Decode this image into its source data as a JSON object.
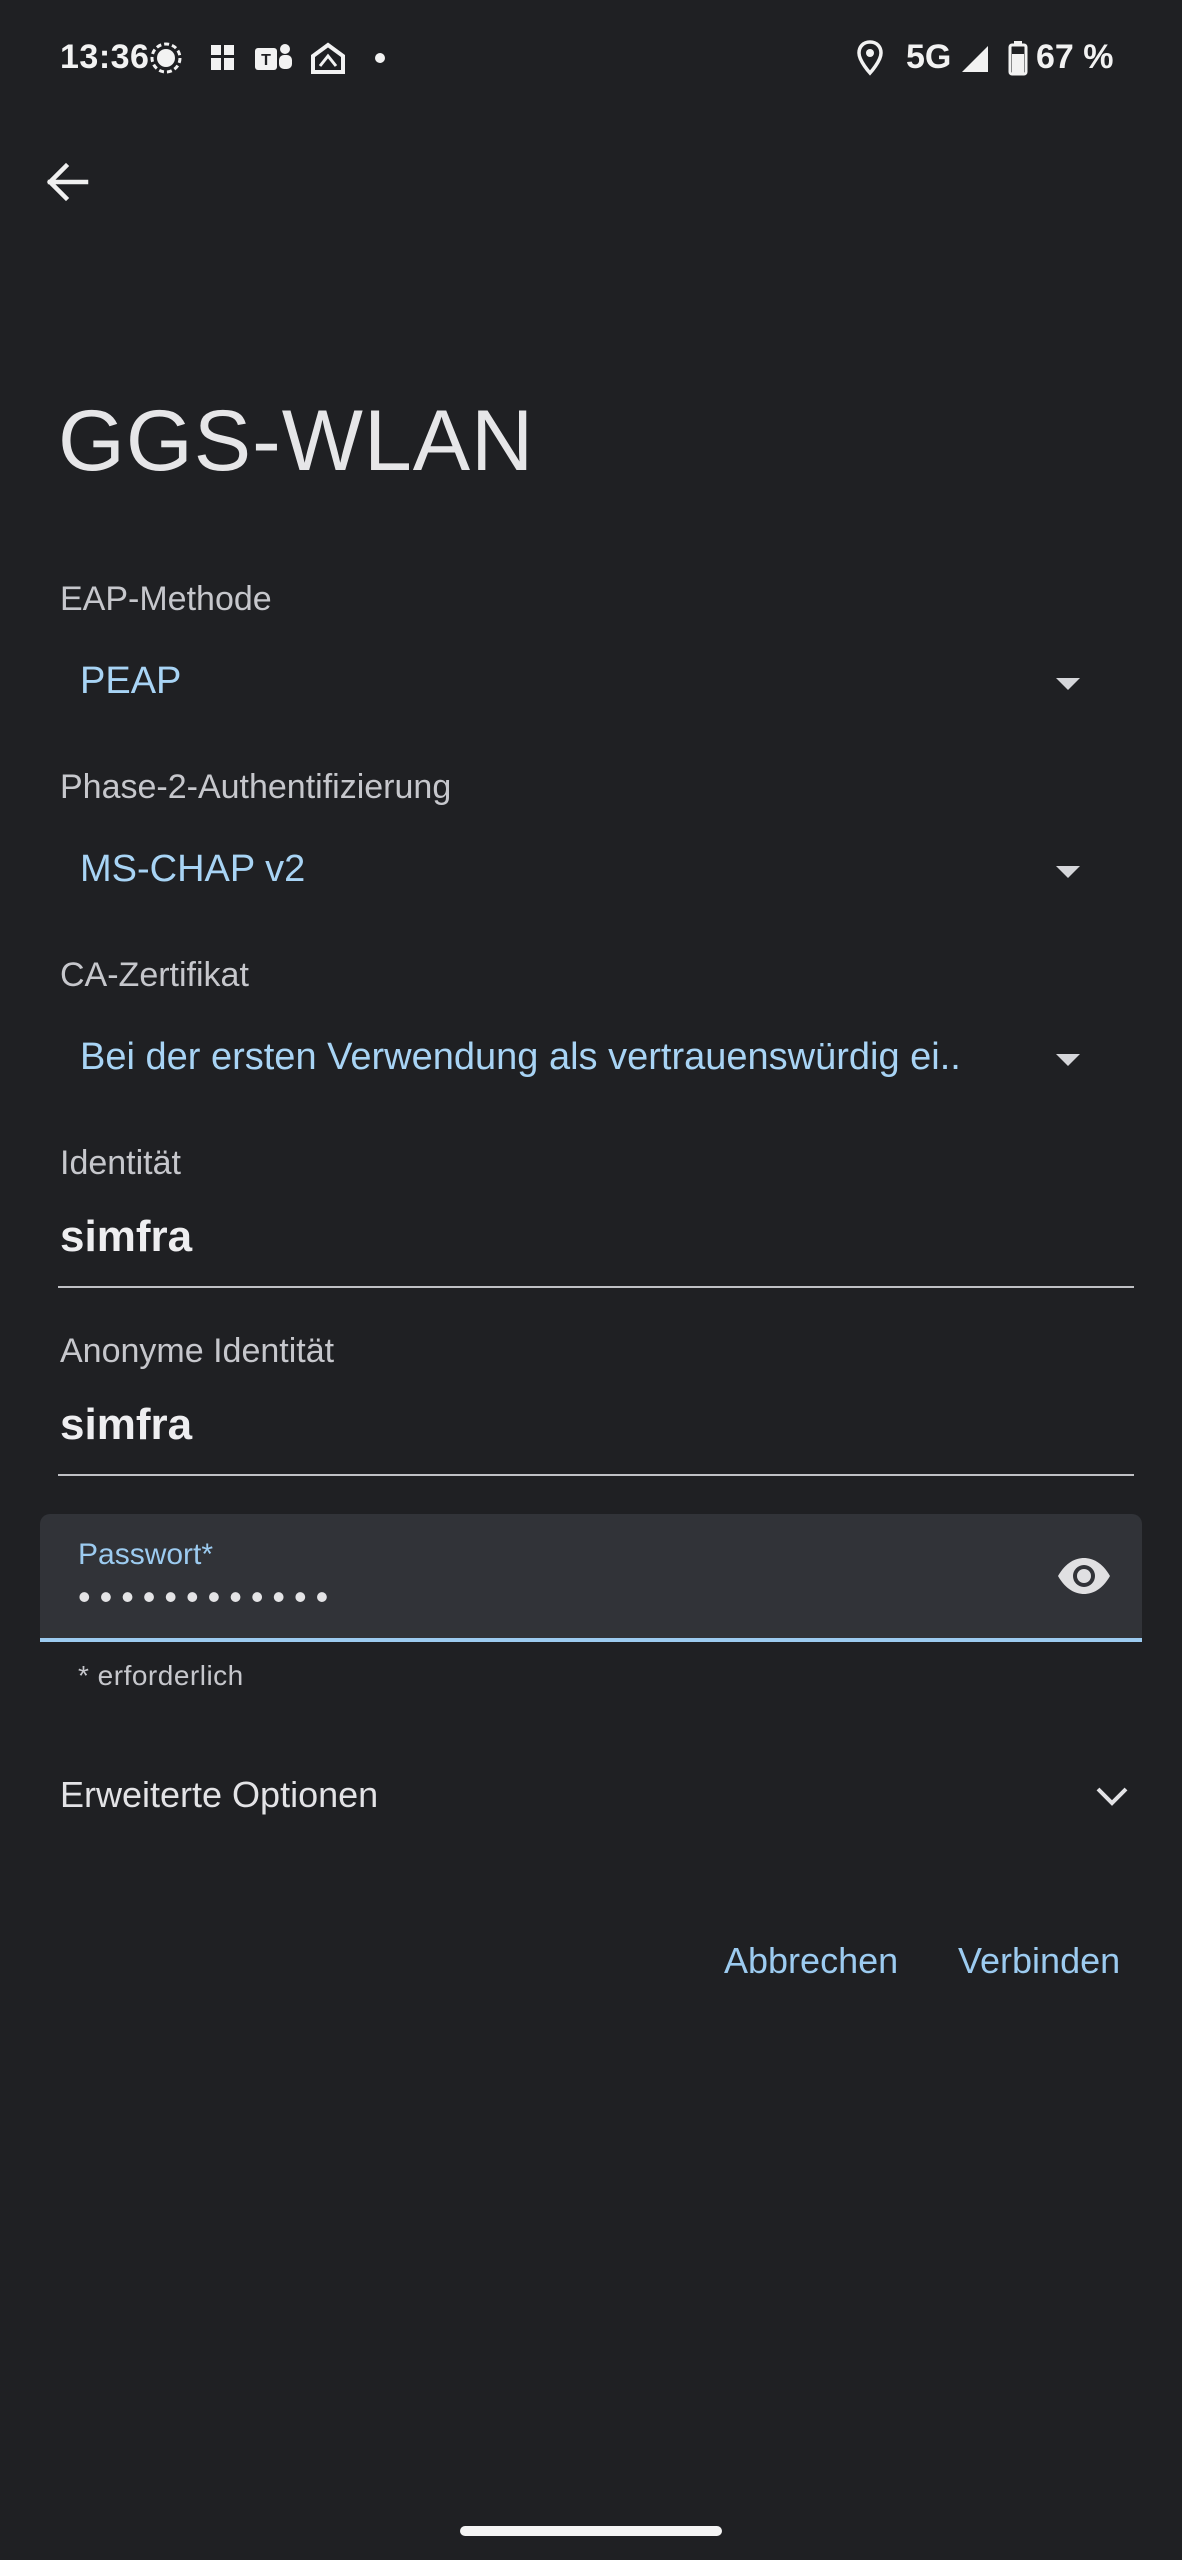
{
  "status_bar": {
    "time": "13:36",
    "network": "5G",
    "battery": "67 %",
    "icons": [
      "signal-messenger-icon",
      "grid-app-icon",
      "teams-icon",
      "home-app-icon",
      "notification-dot-icon",
      "location-icon",
      "cell-signal-icon",
      "battery-icon"
    ]
  },
  "header": {
    "title": "GGS-WLAN"
  },
  "form": {
    "eap_method": {
      "label": "EAP-Methode",
      "value": "PEAP"
    },
    "phase2_auth": {
      "label": "Phase-2-Authentifizierung",
      "value": "MS-CHAP v2"
    },
    "ca_certificate": {
      "label": "CA-Zertifikat",
      "value": "Bei der ersten Verwendung als vertrauenswürdig ei.."
    },
    "identity": {
      "label": "Identität",
      "value": "simfra"
    },
    "anonymous_identity": {
      "label": "Anonyme Identität",
      "value": "simfra"
    },
    "password": {
      "label": "Passwort*",
      "value": "••••••••••••",
      "helper": "* erforderlich"
    },
    "advanced": {
      "label": "Erweiterte Optionen"
    }
  },
  "actions": {
    "cancel": "Abbrechen",
    "connect": "Verbinden"
  },
  "colors": {
    "background": "#1f2023",
    "accent": "#9ccbf0",
    "dropdown_value": "#a8d4f5"
  }
}
